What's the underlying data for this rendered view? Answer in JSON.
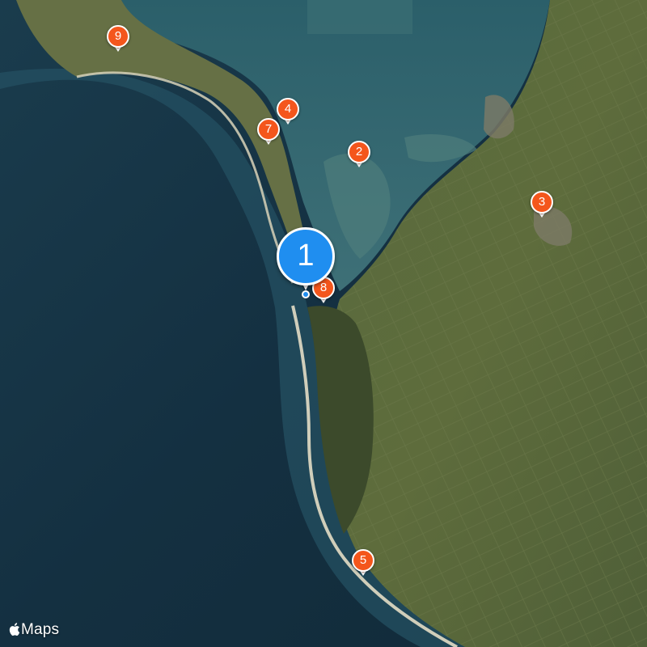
{
  "map": {
    "style": "satellite",
    "colors": {
      "ocean": "#15303f",
      "land": "#5b6b3b",
      "forest": "#3d4a2a",
      "pin": "#f4561c",
      "primary_pin": "#1f8ef0"
    }
  },
  "pins": [
    {
      "label": "2"
    },
    {
      "label": "3"
    },
    {
      "label": "4"
    },
    {
      "label": "5"
    },
    {
      "label": "7"
    },
    {
      "label": "8"
    },
    {
      "label": "9"
    }
  ],
  "primary_pin": {
    "label": "1"
  },
  "attribution": {
    "icon": "apple-logo-icon",
    "text": "Maps"
  }
}
